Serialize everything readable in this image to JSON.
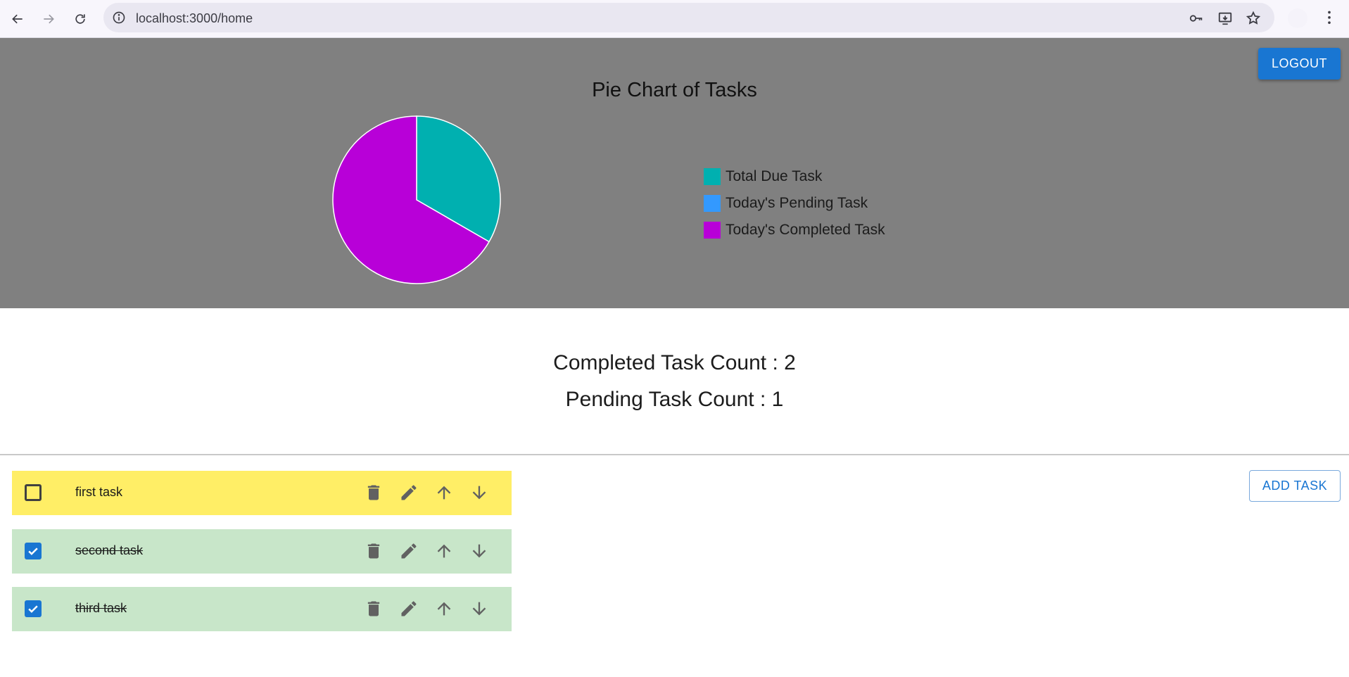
{
  "browser": {
    "url": "localhost:3000/home"
  },
  "header": {
    "logout_label": "LOGOUT"
  },
  "chart_data": {
    "type": "pie",
    "title": "Pie Chart of Tasks",
    "slices": [
      {
        "label": "Total Due Task",
        "value": 1,
        "color": "#00b0b0"
      },
      {
        "label": "Today's Pending Task",
        "value": 0,
        "color": "#3399ff"
      },
      {
        "label": "Today's Completed Task",
        "value": 2,
        "color": "#b800d8"
      }
    ],
    "legend_position": "right",
    "start_angle": "top",
    "direction": "clockwise"
  },
  "counts": {
    "completed": "Completed Task Count : 2",
    "pending": "Pending Task Count : 1"
  },
  "actions": {
    "add_task_label": "ADD TASK"
  },
  "tasks": [
    {
      "text": "first task",
      "completed": false
    },
    {
      "text": "second task",
      "completed": true
    },
    {
      "text": "third task",
      "completed": true
    }
  ],
  "colors": {
    "primary": "#1976d2",
    "pending_row": "#ffee66",
    "done_row": "#c8e6c9",
    "panel_bg": "#808080"
  }
}
